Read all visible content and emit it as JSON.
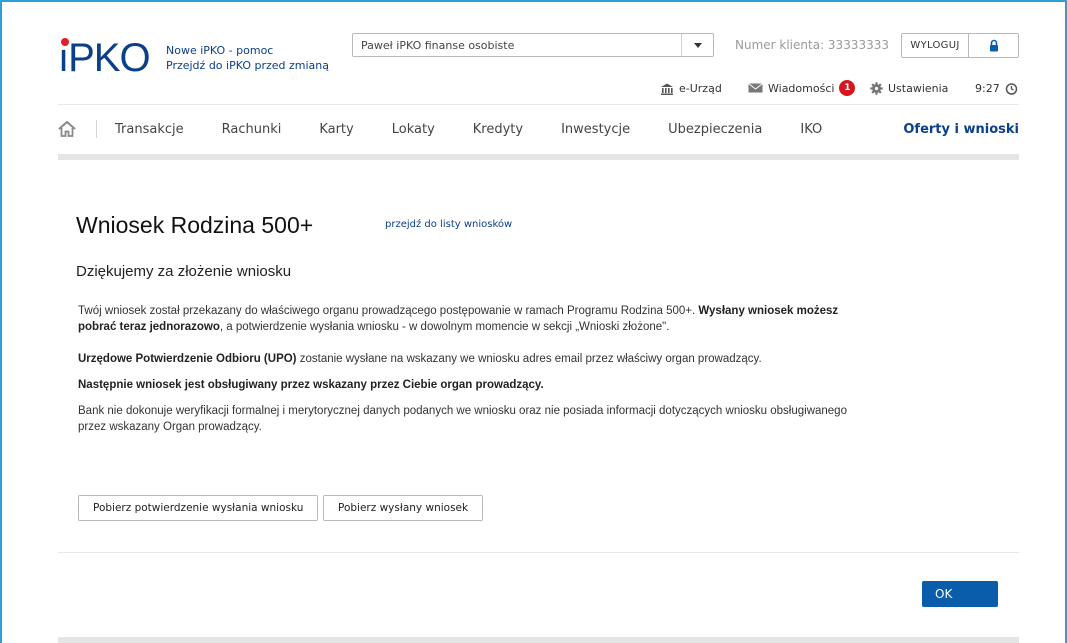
{
  "header": {
    "logo_text": "PKO",
    "link_help": "Nowe iPKO - pomoc",
    "link_old": "Przejdź do iPKO przed zmianą",
    "account_select_value": "Paweł iPKO finanse osobiste",
    "client_number": "Numer klienta: 33333333",
    "logout_label": "WYLOGUJ",
    "e_urzad": "e-Urząd",
    "messages": "Wiadomości",
    "messages_count": "1",
    "settings": "Ustawienia",
    "time": "9:27"
  },
  "nav": {
    "items": [
      "Transakcje",
      "Rachunki",
      "Karty",
      "Lokaty",
      "Kredyty",
      "Inwestycje",
      "Ubezpieczenia",
      "IKO"
    ],
    "right": "Oferty i wnioski"
  },
  "content": {
    "title": "Wniosek Rodzina 500+",
    "title_link": "przejdź do listy wniosków",
    "subtitle": "Dziękujemy za złożenie wniosku",
    "p1_a": "Twój wniosek został przekazany do właściwego organu prowadzącego postępowanie w ramach Programu Rodzina 500+. ",
    "p1_b": "Wysłany wniosek możesz pobrać teraz jednorazowo",
    "p1_c": ", a potwierdzenie wysłania wniosku  - w dowolnym momencie w sekcji  „Wnioski złożone\".",
    "p2_a": "Urzędowe Potwierdzenie Odbioru (UPO)",
    "p2_b": " zostanie wysłane na wskazany we wniosku adres email przez właściwy organ prowadzący.",
    "p3": "Następnie wniosek jest obsługiwany przez wskazany przez Ciebie organ prowadzący.",
    "p4": "Bank nie dokonuje weryfikacji formalnej i merytorycznej danych podanych we wniosku oraz nie posiada informacji dotyczących wniosku obsługiwanego przez wskazany Organ prowadzący."
  },
  "actions": {
    "download_confirmation": "Pobierz potwierdzenie wysłania wniosku",
    "download_application": "Pobierz wysłany wniosek",
    "ok": "OK"
  },
  "colors": {
    "brand_blue": "#0a3f8a",
    "accent_red": "#e31e24",
    "ok_button": "#0a5dab",
    "frame_border": "#2e9fd8"
  }
}
